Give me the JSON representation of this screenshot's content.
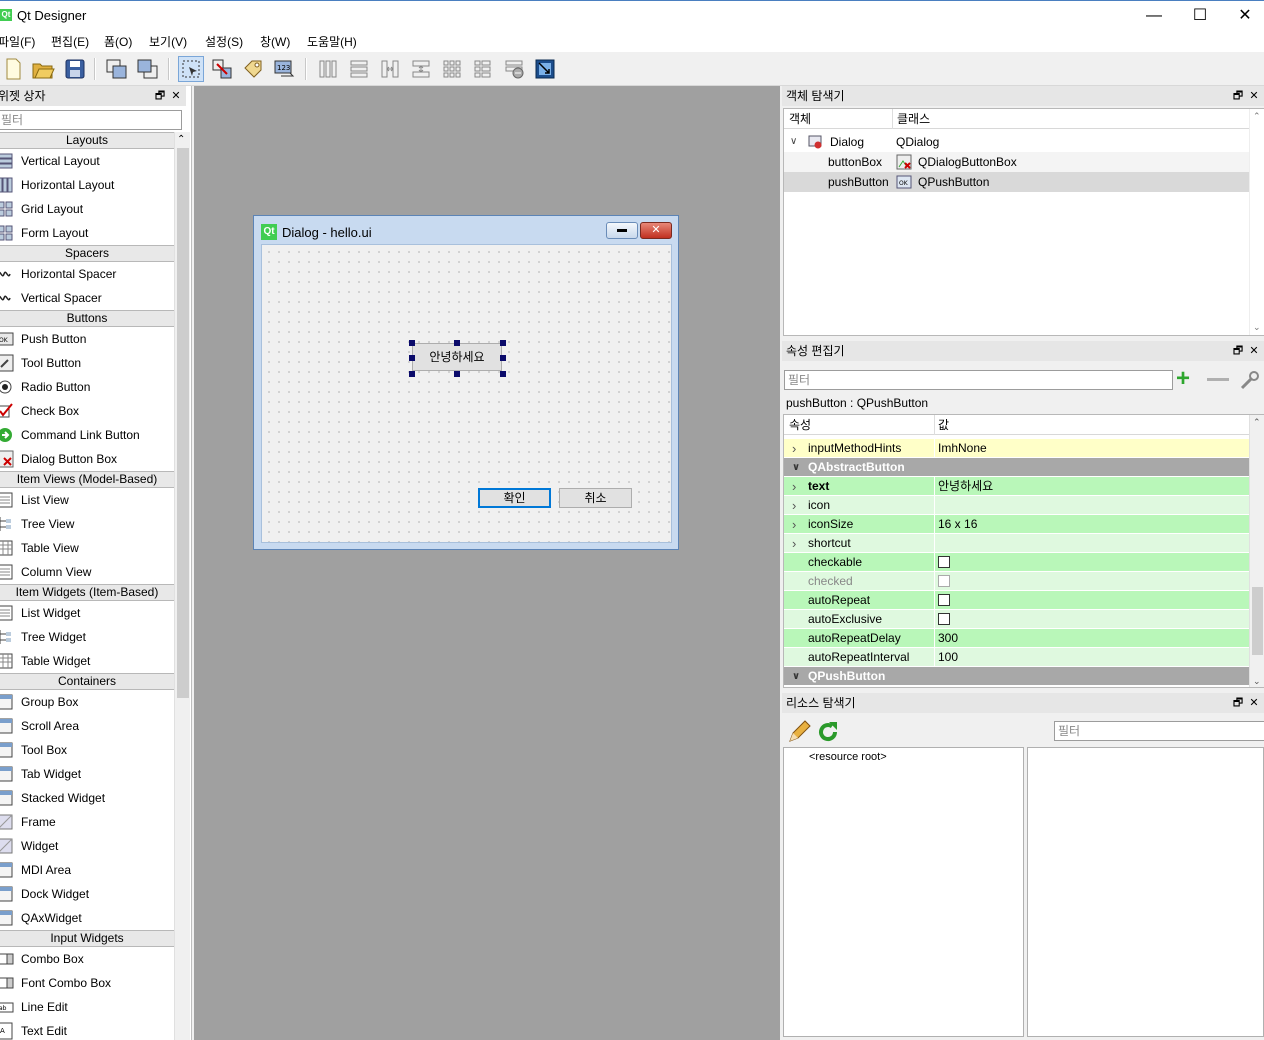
{
  "window": {
    "title": "Qt Designer",
    "logo": "Qt",
    "minimize": "—",
    "maximize": "☐",
    "close": "✕"
  },
  "menu": [
    "파일(F)",
    "편집(E)",
    "폼(O)",
    "보기(V)",
    "설정(S)",
    "창(W)",
    "도움말(H)"
  ],
  "widget_box": {
    "title": "위젯 상자",
    "filter_placeholder": "필터",
    "categories": [
      {
        "name": "Layouts",
        "items": [
          "Vertical Layout",
          "Horizontal Layout",
          "Grid Layout",
          "Form Layout"
        ]
      },
      {
        "name": "Spacers",
        "items": [
          "Horizontal Spacer",
          "Vertical Spacer"
        ]
      },
      {
        "name": "Buttons",
        "items": [
          "Push Button",
          "Tool Button",
          "Radio Button",
          "Check Box",
          "Command Link Button",
          "Dialog Button Box"
        ]
      },
      {
        "name": "Item Views (Model-Based)",
        "items": [
          "List View",
          "Tree View",
          "Table View",
          "Column View"
        ]
      },
      {
        "name": "Item Widgets (Item-Based)",
        "items": [
          "List Widget",
          "Tree Widget",
          "Table Widget"
        ]
      },
      {
        "name": "Containers",
        "items": [
          "Group Box",
          "Scroll Area",
          "Tool Box",
          "Tab Widget",
          "Stacked Widget",
          "Frame",
          "Widget",
          "MDI Area",
          "Dock Widget",
          "QAxWidget"
        ]
      },
      {
        "name": "Input Widgets",
        "items": [
          "Combo Box",
          "Font Combo Box",
          "Line Edit",
          "Text Edit"
        ]
      }
    ]
  },
  "dialog": {
    "title": "Dialog - hello.ui",
    "logo": "Qt",
    "push_button": "안녕하세요",
    "ok_button": "확인",
    "cancel_button": "취소"
  },
  "object_inspector": {
    "title": "객체 탐색기",
    "col_object": "객체",
    "col_class": "클래스",
    "rows": [
      {
        "object": "Dialog",
        "class": "QDialog"
      },
      {
        "object": "buttonBox",
        "class": "QDialogButtonBox"
      },
      {
        "object": "pushButton",
        "class": "QPushButton"
      }
    ]
  },
  "property_editor": {
    "title": "속성 편집기",
    "filter_placeholder": "필터",
    "subject": "pushButton : QPushButton",
    "col_property": "속성",
    "col_value": "값",
    "rows": [
      {
        "name": "inputMethodHints",
        "value": "ImhNone"
      },
      {
        "group": "QAbstractButton"
      },
      {
        "name": "text",
        "value": "안녕하세요"
      },
      {
        "name": "icon",
        "value": ""
      },
      {
        "name": "iconSize",
        "value": "16 x 16"
      },
      {
        "name": "shortcut",
        "value": ""
      },
      {
        "name": "checkable",
        "value": ""
      },
      {
        "name": "checked",
        "value": ""
      },
      {
        "name": "autoRepeat",
        "value": ""
      },
      {
        "name": "autoExclusive",
        "value": ""
      },
      {
        "name": "autoRepeatDelay",
        "value": "300"
      },
      {
        "name": "autoRepeatInterval",
        "value": "100"
      },
      {
        "group": "QPushButton"
      }
    ]
  },
  "resource_browser": {
    "title": "리소스 탐색기",
    "filter_placeholder": "필터",
    "root": "<resource root>"
  },
  "colors": {
    "mdi_background": "#a0a0a0",
    "property_green": "#b9f7b9",
    "property_yellow": "#ffffc8",
    "group_header": "#a8a8a8",
    "selection": "#d9d9d9"
  }
}
